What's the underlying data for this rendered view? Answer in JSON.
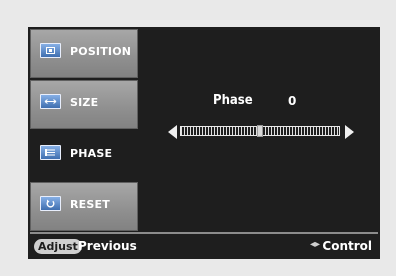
{
  "menu": {
    "items": [
      {
        "label": "POSITION",
        "icon": "position-icon"
      },
      {
        "label": "SIZE",
        "icon": "size-icon"
      },
      {
        "label": "PHASE",
        "icon": "phase-icon",
        "active": true
      },
      {
        "label": "RESET",
        "icon": "reset-icon"
      }
    ]
  },
  "panel": {
    "title": "Phase",
    "value": "0",
    "slider_level": 0.5
  },
  "footer": {
    "adjust": "Adjust",
    "previous": "Previous",
    "control_arrows": "◂▸",
    "control": "Control"
  },
  "colors": {
    "screen_bg": "#1e1e1e",
    "menu_item_bg": "#9a9a9a",
    "icon_blue": "#5b8bd0"
  }
}
